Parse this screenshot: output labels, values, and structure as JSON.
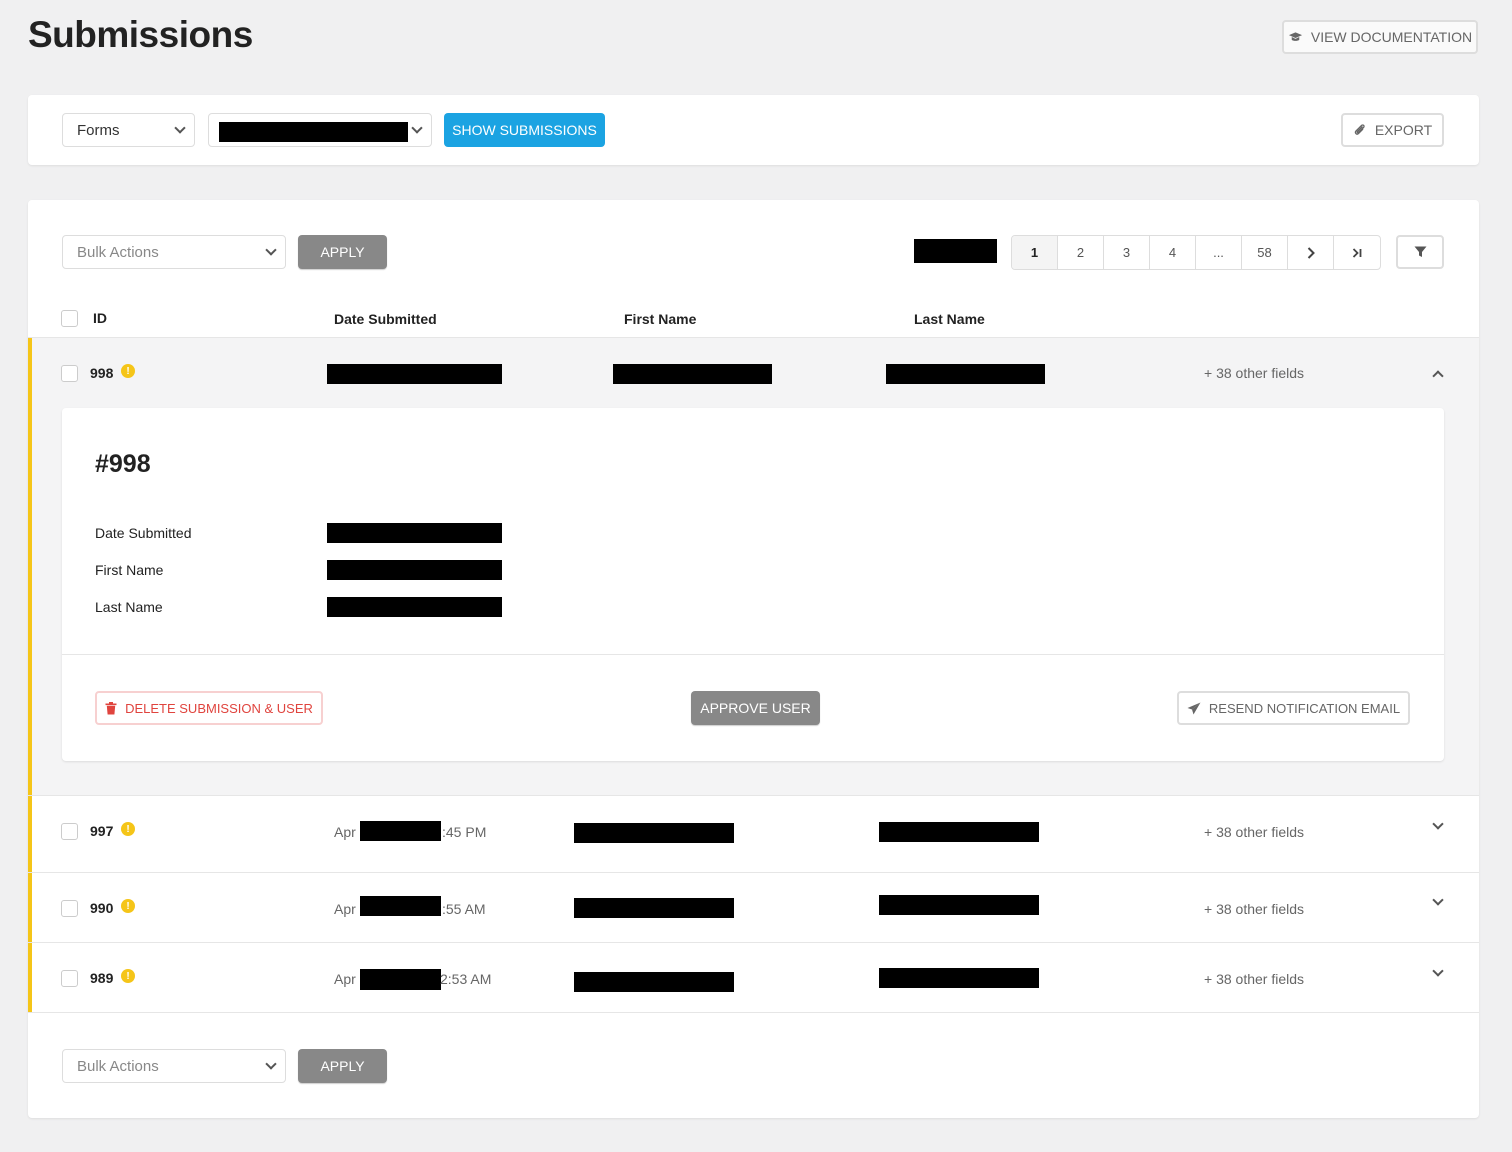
{
  "header": {
    "title": "Submissions",
    "view_docs_label": "VIEW DOCUMENTATION"
  },
  "toolbar": {
    "forms_select": "Forms",
    "show_submissions_label": "SHOW SUBMISSIONS",
    "export_label": "EXPORT"
  },
  "list_controls": {
    "bulk_actions": "Bulk Actions",
    "apply_label": "APPLY",
    "pagination": [
      "1",
      "2",
      "3",
      "4",
      "...",
      "58"
    ]
  },
  "table": {
    "headers": {
      "id": "ID",
      "date": "Date Submitted",
      "first": "First Name",
      "last": "Last Name"
    },
    "rows": [
      {
        "id": "998",
        "date_prefix": "",
        "date_suffix": "",
        "other": "+ 38 other fields",
        "expanded": true
      },
      {
        "id": "997",
        "date_prefix": "Apr",
        "date_suffix": ":45 PM",
        "other": "+ 38 other fields",
        "expanded": false
      },
      {
        "id": "990",
        "date_prefix": "Apr",
        "date_suffix": ":55 AM",
        "other": "+ 38 other fields",
        "expanded": false
      },
      {
        "id": "989",
        "date_prefix": "Apr",
        "date_suffix": "2:53 AM",
        "other": "+ 38 other fields",
        "expanded": false
      }
    ]
  },
  "detail": {
    "title": "#998",
    "labels": {
      "date": "Date Submitted",
      "first": "First Name",
      "last": "Last Name"
    },
    "delete_label": "DELETE SUBMISSION & USER",
    "approve_label": "APPROVE USER",
    "resend_label": "RESEND NOTIFICATION EMAIL"
  },
  "colors": {
    "accent_blue": "#1ba3e2",
    "pending_yellow": "#f5c518",
    "danger_red": "#e0443e"
  },
  "icons": [
    "graduation-cap-icon",
    "paperclip-icon",
    "filter-icon",
    "trash-icon",
    "paper-plane-icon",
    "warning-icon",
    "chevron-down-icon",
    "chevron-up-icon",
    "chevron-right-icon",
    "last-page-icon"
  ]
}
